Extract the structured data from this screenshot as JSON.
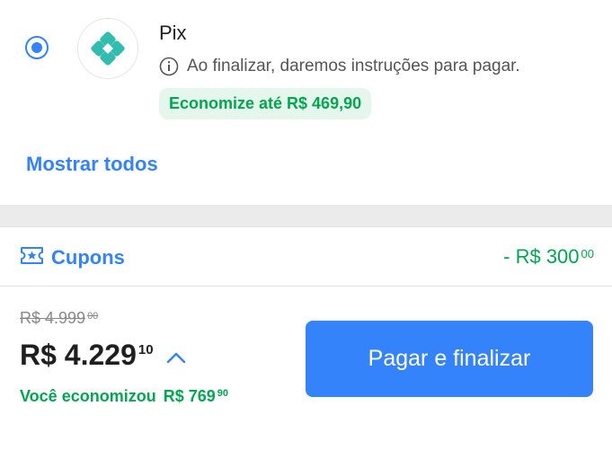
{
  "payment_option": {
    "title": "Pix",
    "info": "Ao finalizar, daremos instruções para pagar.",
    "promo": "Economize até R$ 469,90",
    "selected": true,
    "icon": "pix-logo-icon",
    "brand_color": "#32bcad"
  },
  "show_all_label": "Mostrar todos",
  "coupons": {
    "label": "Cupons",
    "discount_main": "- R$ 300",
    "discount_cents": "00",
    "icon": "ticket-star-icon"
  },
  "summary": {
    "old_price_main": "R$ 4.999",
    "old_price_cents": "00",
    "total_main": "R$ 4.229",
    "total_cents": "10",
    "savings_label": "Você economizou",
    "savings_main": "R$ 769",
    "savings_cents": "90"
  },
  "pay_button_label": "Pagar e finalizar",
  "colors": {
    "accent": "#3483fa",
    "success": "#00a650",
    "success_bg": "#e5f6ec"
  }
}
